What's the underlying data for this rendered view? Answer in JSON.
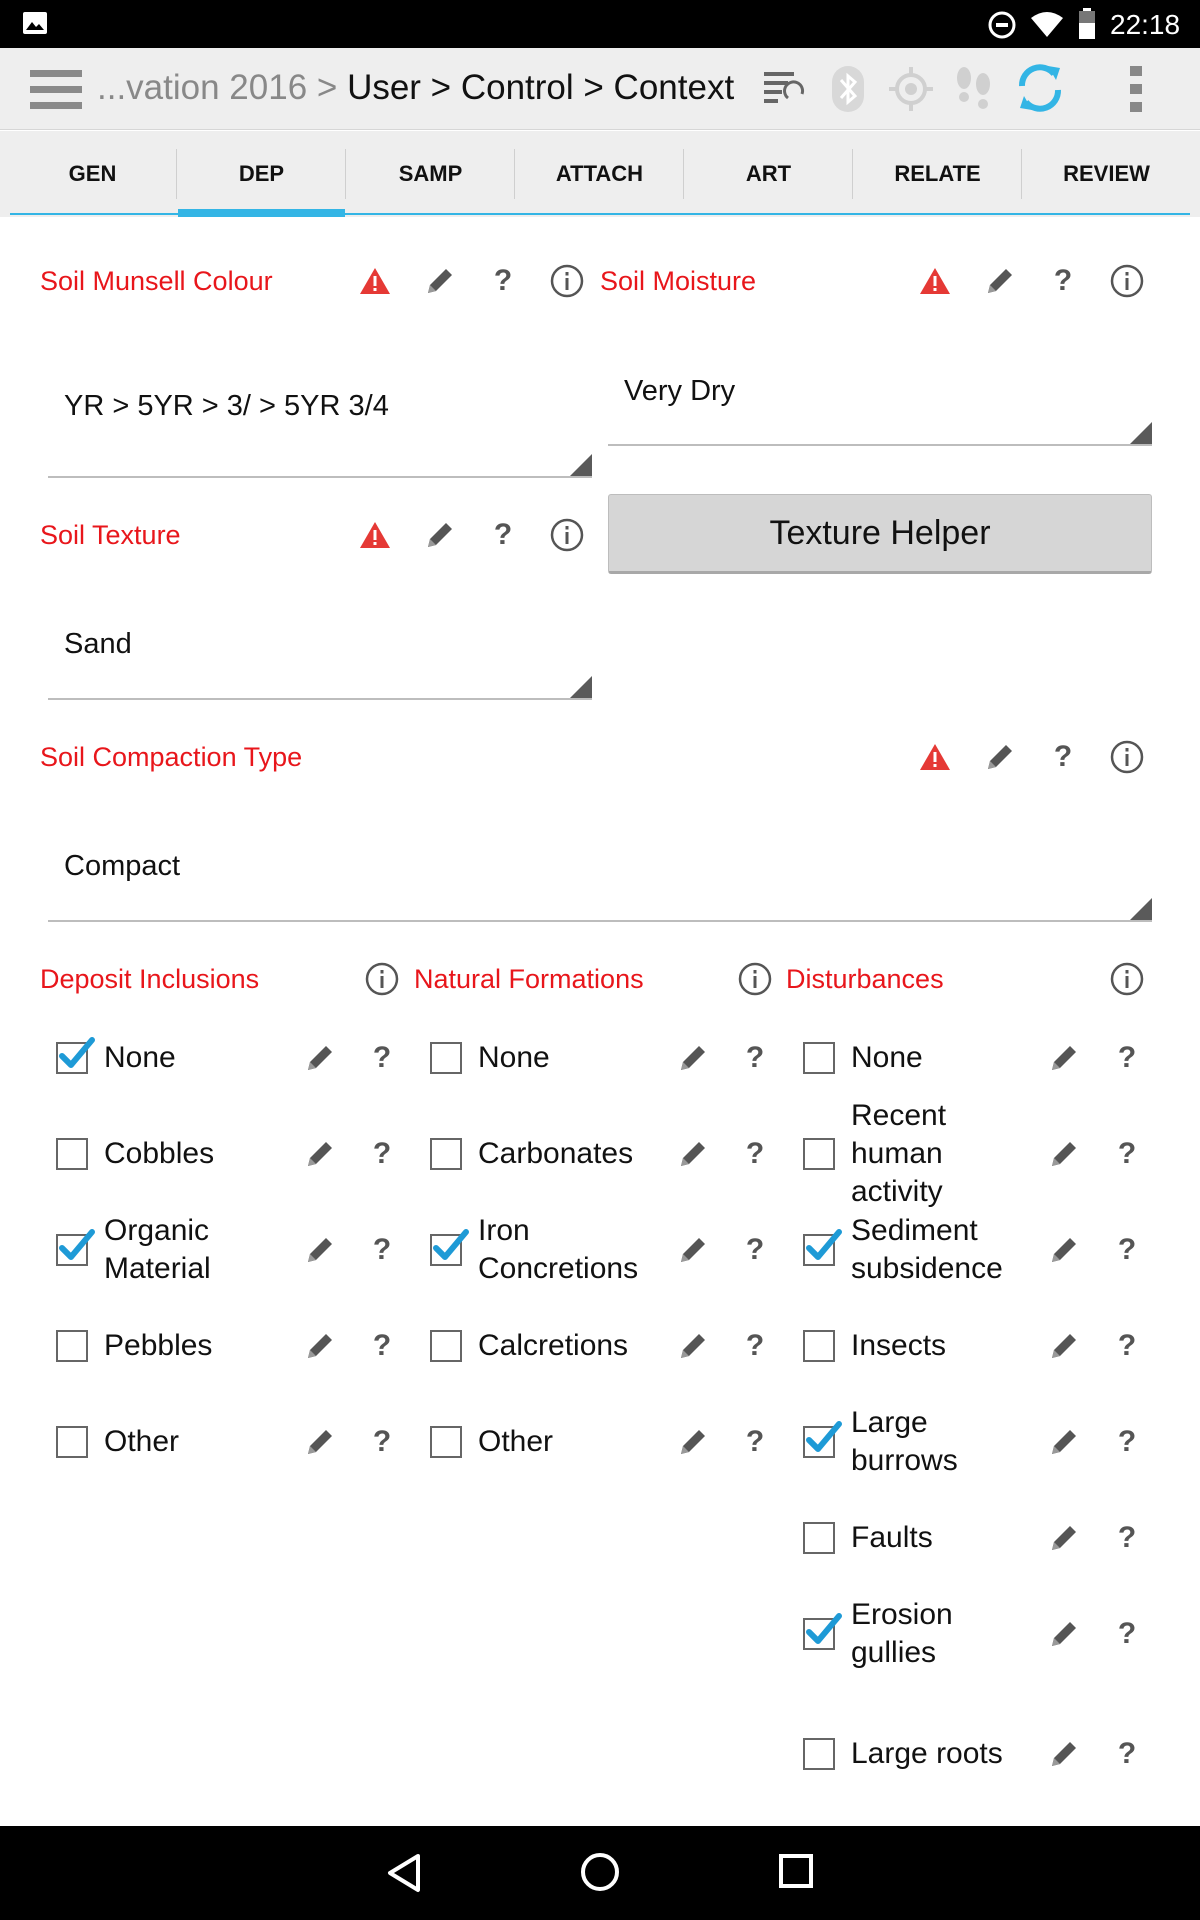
{
  "status_bar": {
    "time": "22:18"
  },
  "app_bar": {
    "breadcrumb_prefix": "...vation 2016 >",
    "breadcrumb_path": "User > Control > Context"
  },
  "tabs": [
    {
      "label": "GEN"
    },
    {
      "label": "DEP"
    },
    {
      "label": "SAMP"
    },
    {
      "label": "ATTACH"
    },
    {
      "label": "ART"
    },
    {
      "label": "RELATE"
    },
    {
      "label": "REVIEW"
    }
  ],
  "selected_tab": "DEP",
  "fields": {
    "munsell": {
      "label": "Soil Munsell Colour",
      "value": "YR > 5YR > 3/ > 5YR 3/4"
    },
    "moisture": {
      "label": "Soil Moisture",
      "value": "Very Dry"
    },
    "texture": {
      "label": "Soil Texture",
      "value": "Sand",
      "helper_button": "Texture Helper"
    },
    "compaction": {
      "label": "Soil Compaction Type",
      "value": "Compact"
    }
  },
  "groups": {
    "inclusions": {
      "label": "Deposit Inclusions",
      "items": [
        {
          "label": "None",
          "checked": true
        },
        {
          "label": "Cobbles",
          "checked": false
        },
        {
          "label": "Organic Material",
          "checked": true
        },
        {
          "label": "Pebbles",
          "checked": false
        },
        {
          "label": "Other",
          "checked": false
        }
      ]
    },
    "formations": {
      "label": "Natural Formations",
      "items": [
        {
          "label": "None",
          "checked": false
        },
        {
          "label": "Carbonates",
          "checked": false
        },
        {
          "label": "Iron Concretions",
          "checked": true
        },
        {
          "label": "Calcretions",
          "checked": false
        },
        {
          "label": "Other",
          "checked": false
        }
      ]
    },
    "disturbances": {
      "label": "Disturbances",
      "items": [
        {
          "label": "None",
          "checked": false
        },
        {
          "label": "Recent human activity",
          "checked": false
        },
        {
          "label": "Sediment subsidence",
          "checked": true
        },
        {
          "label": "Insects",
          "checked": false
        },
        {
          "label": "Large burrows",
          "checked": true
        },
        {
          "label": "Faults",
          "checked": false
        },
        {
          "label": "Erosion gullies",
          "checked": true
        },
        {
          "label": "Large roots",
          "checked": false
        }
      ]
    }
  },
  "help_glyph": "?",
  "colors": {
    "label_red": "#e8161b",
    "accent_blue": "#33b5e5",
    "warning_red": "#e53935",
    "check_blue": "#1e9ad6"
  }
}
